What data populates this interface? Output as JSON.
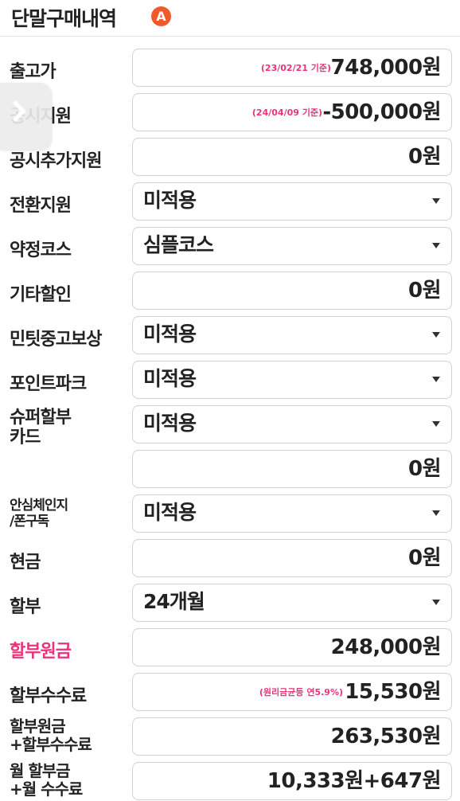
{
  "header": {
    "title": "단말구매내역",
    "badge": "A"
  },
  "rows": {
    "release_price": {
      "label": "출고가",
      "note": "(23/02/21 기준)",
      "value": "748,000원"
    },
    "public_support": {
      "label": "공시지원",
      "note": "(24/04/09 기준)",
      "value": "-500,000원"
    },
    "extra_support": {
      "label": "공시추가지원",
      "value": "0원"
    },
    "switch_support": {
      "label": "전환지원",
      "selected": "미적용"
    },
    "contract_course": {
      "label": "약정코스",
      "selected": "심플코스"
    },
    "other_discount": {
      "label": "기타할인",
      "value": "0원"
    },
    "mint_tradein": {
      "label": "민팃중고보상",
      "selected": "미적용"
    },
    "point_park": {
      "label": "포인트파크",
      "selected": "미적용"
    },
    "super_card": {
      "label_line1": "슈퍼할부",
      "label_line2": "카드",
      "selected": "미적용",
      "amount": "0원"
    },
    "safe_subscription": {
      "label_line1": "안심체인지",
      "label_line2": "/폰구독",
      "selected": "미적용"
    },
    "cash": {
      "label": "현금",
      "value": "0원"
    },
    "installment": {
      "label": "할부",
      "selected": "24개월"
    },
    "principal": {
      "label": "할부원금",
      "value": "248,000원"
    },
    "fee": {
      "label": "할부수수료",
      "note": "(원리금균등 연5.9%)",
      "value": "15,530원"
    },
    "principal_plus_fee": {
      "label_line1": "할부원금",
      "label_line2": "+할부수수료",
      "value": "263,530원"
    },
    "monthly": {
      "label_line1": "월 할부금",
      "label_line2": "+월 수수료",
      "value": "10,333원+647원"
    }
  }
}
